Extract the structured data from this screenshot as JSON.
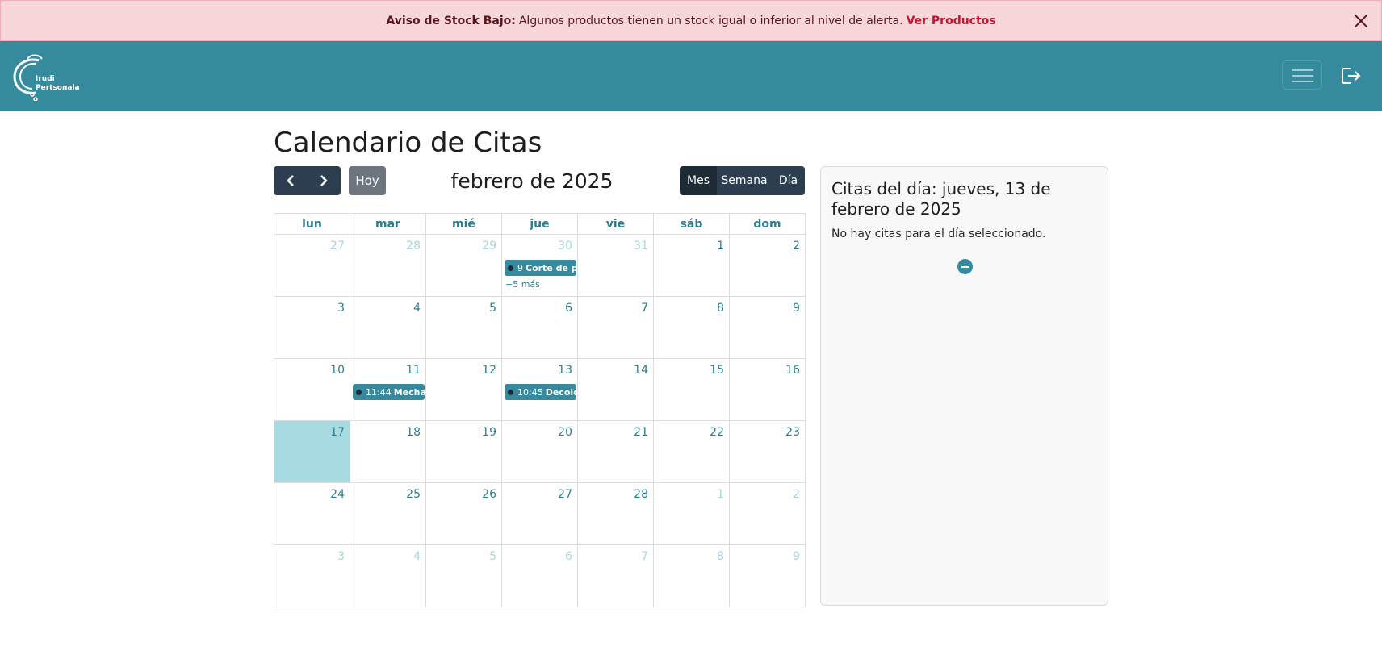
{
  "alert": {
    "heading": "Aviso de Stock Bajo:",
    "message": "Algunos productos tienen un stock igual o inferior al nivel de alerta.",
    "link": "Ver Productos",
    "close_icon": "close-icon"
  },
  "navbar": {
    "brand_line1": "Irudi",
    "brand_line2": "Pertsonala",
    "menu_icon": "hamburger-icon",
    "logout_icon": "logout-icon"
  },
  "page": {
    "title": "Calendario de Citas"
  },
  "toolbar": {
    "prev_icon": "chevron-left-icon",
    "next_icon": "chevron-right-icon",
    "today_label": "Hoy",
    "month_title": "febrero de 2025",
    "views": [
      "Mes",
      "Semana",
      "Día"
    ],
    "active_view": "Mes"
  },
  "calendar": {
    "weekdays": [
      "lun",
      "mar",
      "mié",
      "jue",
      "vie",
      "sáb",
      "dom"
    ],
    "weeks": [
      [
        {
          "d": "27",
          "o": true
        },
        {
          "d": "28",
          "o": true
        },
        {
          "d": "29",
          "o": true
        },
        {
          "d": "30",
          "o": true
        },
        {
          "d": "31",
          "o": true
        },
        {
          "d": "1"
        },
        {
          "d": "2"
        }
      ],
      [
        {
          "d": "3"
        },
        {
          "d": "4"
        },
        {
          "d": "5"
        },
        {
          "d": "6"
        },
        {
          "d": "7"
        },
        {
          "d": "8"
        },
        {
          "d": "9"
        }
      ],
      [
        {
          "d": "10"
        },
        {
          "d": "11"
        },
        {
          "d": "12"
        },
        {
          "d": "13"
        },
        {
          "d": "14"
        },
        {
          "d": "15"
        },
        {
          "d": "16"
        }
      ],
      [
        {
          "d": "17",
          "today": true
        },
        {
          "d": "18"
        },
        {
          "d": "19"
        },
        {
          "d": "20"
        },
        {
          "d": "21"
        },
        {
          "d": "22"
        },
        {
          "d": "23"
        }
      ],
      [
        {
          "d": "24"
        },
        {
          "d": "25"
        },
        {
          "d": "26"
        },
        {
          "d": "27"
        },
        {
          "d": "28"
        },
        {
          "d": "1",
          "o": true
        },
        {
          "d": "2",
          "o": true
        }
      ],
      [
        {
          "d": "3",
          "o": true
        },
        {
          "d": "4",
          "o": true
        },
        {
          "d": "5",
          "o": true
        },
        {
          "d": "6",
          "o": true
        },
        {
          "d": "7",
          "o": true
        },
        {
          "d": "8",
          "o": true
        },
        {
          "d": "9",
          "o": true
        }
      ]
    ],
    "events": [
      {
        "week": 0,
        "day": 3,
        "time": "9",
        "title": "Corte de pe",
        "more": "+5 más"
      },
      {
        "week": 2,
        "day": 1,
        "time": "11:44",
        "title": "Mechas"
      },
      {
        "week": 2,
        "day": 3,
        "time": "10:45",
        "title": "Decolor"
      }
    ],
    "accent": "#358a9d",
    "today_bg": "#a7dbe1"
  },
  "side_panel": {
    "title": "Citas del día: jueves, 13 de febrero de 2025",
    "empty": "No hay citas para el día seleccionado.",
    "add_icon": "plus-circle-icon"
  }
}
